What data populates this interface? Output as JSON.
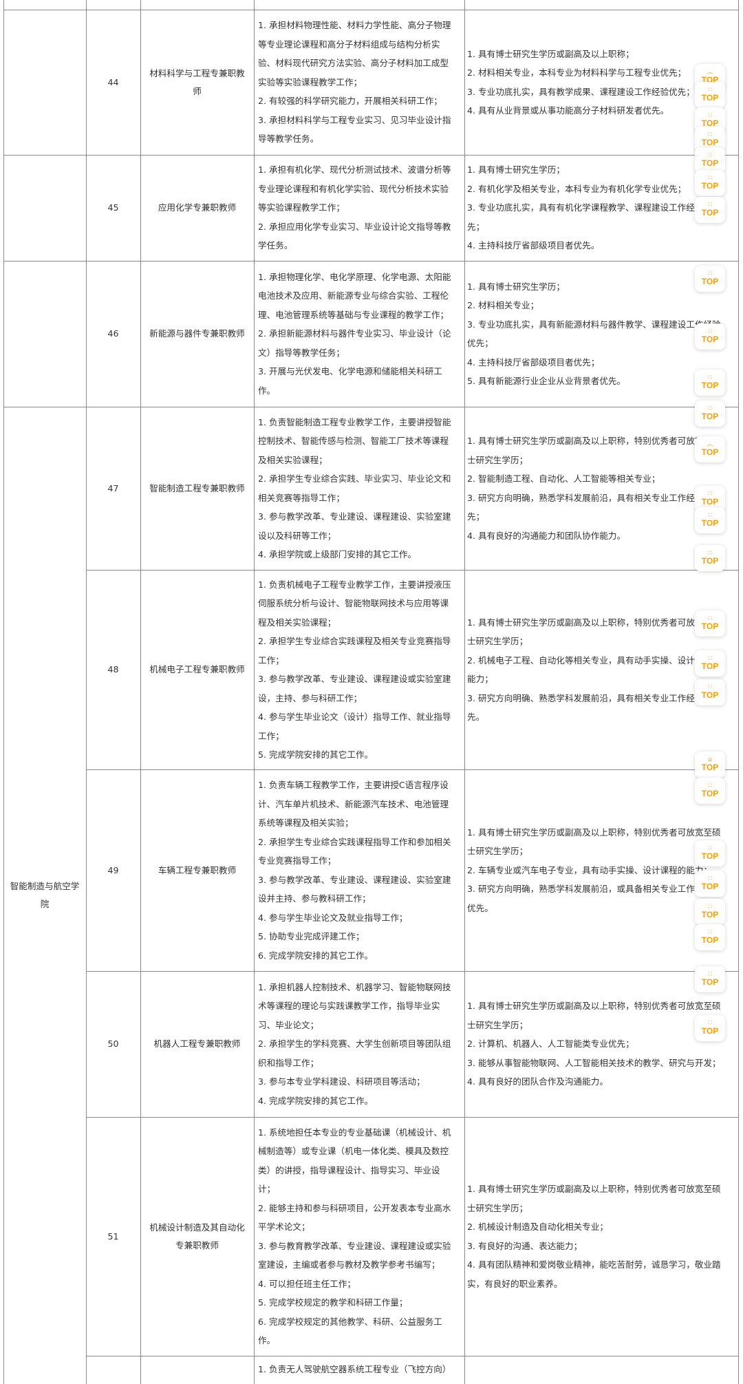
{
  "department": "智能制造与航空学院",
  "rows": [
    {
      "no": "44",
      "position": "材料科学与工程专兼职教师",
      "duties": [
        "1. 承担材料物理性能、材料力学性能、高分子物理",
        "等专业理论课程和高分子材料组成与结构分析实",
        "验、材料现代研究方法实验、高分子材料加工成型",
        "实验等实验课程教学工作；",
        "2. 有较强的科学研究能力，开展相关科研工作；",
        "3. 承担材料科学与工程专业实习、见习毕业设计指",
        "导等教学任务。"
      ],
      "requirements": [
        "1. 具有博士研究生学历或副高及以上职称；",
        "2. 材料相关专业，本科专业为材料科学与工程专业优先；",
        "3. 专业功底扎实，具有教学成果、课程建设工作经验优先；",
        "4. 具有从业背景或从事功能高分子材料研发者优先。"
      ]
    },
    {
      "no": "45",
      "position": "应用化学专兼职教师",
      "duties": [
        "1. 承担有机化学、现代分析测试技术、波谱分析等",
        "专业理论课程和有机化学实验、现代分析技术实验",
        "等实验课程教学工作；",
        "2. 承担应用化学专业实习、毕业设计论文指导等教",
        "学任务。"
      ],
      "requirements": [
        "1. 具有博士研究生学历；",
        "2. 有机化学及相关专业，本科专业为有机化学专业优先；",
        "3. 专业功底扎实，具有有机化学课程教学、课程建设工作经验优",
        "先；",
        "4. 主持科技厅省部级项目者优先。"
      ]
    },
    {
      "no": "46",
      "position": "新能源与器件专兼职教师",
      "duties": [
        "1. 承担物理化学、电化学原理、化学电源、太阳能",
        "电池技术及应用、新能源专业与综合实验、工程伦",
        "理、电池管理系统等基础与专业课程的教学工作；",
        "2. 承担新能源材料与器件专业实习、毕业设计（论",
        "文）指导等教学任务；",
        "3. 开展与光伏发电、化学电源和储能相关科研工",
        "作。"
      ],
      "requirements": [
        "1. 具有博士研究生学历；",
        "2. 材料相关专业；",
        "3. 专业功底扎实，具有新能源材料与器件教学、课程建设工作经验",
        "优先；",
        "4. 主持科技厅省部级项目者优先；",
        "5. 具有新能源行业企业从业背景者优先。"
      ]
    },
    {
      "no": "47",
      "position": "智能制造工程专兼职教师",
      "duties": [
        "1. 负责智能制造工程专业教学工作，主要讲授智能",
        "控制技术、智能传感与检测、智能工厂技术等课程",
        "及相关实验课程；",
        "2. 承担学生专业综合实践、毕业实习、毕业论文和",
        "相关竞赛等指导工作；",
        "3. 参与教学改革、专业建设、课程建设、实验室建",
        "设以及科研等工作；",
        "4. 承担学院或上级部门安排的其它工作。"
      ],
      "requirements": [
        "1. 具有博士研究生学历或副高及以上职称，特别优秀者可放宽至硕",
        "士研究生学历；",
        "2. 智能制造工程、自动化、人工智能等相关专业；",
        "3. 研究方向明确，熟悉学科发展前沿，具有相关专业工作经验者优",
        "先；",
        "4. 具有良好的沟通能力和团队协作能力。"
      ]
    },
    {
      "no": "48",
      "position": "机械电子工程专兼职教师",
      "duties": [
        "1. 负责机械电子工程专业教学工作，主要讲授液压",
        "伺服系统分析与设计、智能物联网技术与应用等课",
        "程及相关实验课程；",
        "2. 承担学生专业综合实践课程及相关专业竞赛指导",
        "工作；",
        "3. 参与教学改革、专业建设、课程建设或实验室建",
        "设，主持、参与科研工作；",
        "4. 参与学生毕业论文（设计）指导工作、就业指导",
        "工作；",
        "5. 完成学院安排的其它工作。"
      ],
      "requirements": [
        "1. 具有博士研究生学历或副高及以上职称，特别优秀者可放宽至硕",
        "士研究生学历；",
        "2. 机械电子工程、自动化等相关专业，具有动手实操、设计课程的",
        "能力；",
        "3. 研究方向明确、熟悉学科发展前沿，具有相关专业工作经验者优",
        "先。"
      ]
    },
    {
      "no": "49",
      "position": "车辆工程专兼职教师",
      "duties": [
        "1. 负责车辆工程教学工作，主要讲授C语言程序设",
        "计、汽车单片机技术、新能源汽车技术、电池管理",
        "系统等课程及相关实验；",
        "2. 承担学生专业综合实践课程指导工作和参加相关",
        "专业竞赛指导工作；",
        "3. 参与教学改革、专业建设、课程建设、实验室建",
        "设并主持、参与教科研工作；",
        "4. 参与学生毕业论文及就业指导工作；",
        "5. 协助专业完成评建工作；",
        "6. 完成学院安排的其它工作。"
      ],
      "requirements": [
        "1. 具有博士研究生学历或副高及以上职称，特别优秀者可放宽至硕",
        "士研究生学历；",
        "2. 车辆专业或汽车电子专业，具有动手实操、设计课程的能力；",
        "3. 研究方向明确，熟悉学科发展前沿，或具备相关专业工作经验者",
        "优先。"
      ]
    },
    {
      "no": "50",
      "position": "机器人工程专兼职教师",
      "duties": [
        "1. 承担机器人控制技术、机器学习、智能物联网技",
        "术等课程的理论与实践课教学工作，指导毕业实",
        "习、毕业论文；",
        "2. 承担学生的学科竞赛、大学生创新项目等团队组",
        "织和指导工作；",
        "3. 参与本专业学科建设、科研项目等活动；",
        "4. 完成学院安排的其它工作。"
      ],
      "requirements": [
        "1. 具有博士研究生学历或副高及以上职称，特别优秀者可放宽至硕",
        "士研究生学历；",
        "2. 计算机、机器人、人工智能类专业优先；",
        "3. 能够从事智能物联网、人工智能相关技术的教学、研究与开发；",
        "4. 具有良好的团队合作及沟通能力。"
      ]
    },
    {
      "no": "51",
      "position": "机械设计制造及其自动化专兼职教师",
      "duties": [
        "1. 系统地担任本专业的专业基础课（机械设计、机",
        "械制造等）或专业课（机电一体化类、模具及数控",
        "类）的讲授，指导课程设计、指导实习、毕业设",
        "计；",
        "2. 能够主持和参与科研项目，公开发表本专业高水",
        "平学术论文；",
        "3. 参与教育教学改革、专业建设、课程建设或实验",
        "室建设，主编或者参与教材及教学参考书编写；",
        "4. 可以担任班主任工作；",
        "5. 完成学校规定的教学和科研工作量；",
        "6. 完成学校规定的其他教学、科研、公益服务工",
        "作。"
      ],
      "requirements": [
        "1. 具有博士研究生学历或副高及以上职称，特别优秀者可放宽至硕",
        "士研究生学历；",
        "2. 机械设计制造及自动化相关专业；",
        "3. 有良好的沟通、表达能力；",
        "4. 具有团队精神和爱岗敬业精神，能吃苦耐劳，诚恳学习，敬业踏",
        "实，有良好的职业素养。"
      ]
    },
    {
      "no": "",
      "position": "",
      "duties": [
        "1. 负责无人驾驶航空器系统工程专业（飞控方向）"
      ],
      "requirements": []
    }
  ],
  "top_badges": [
    {
      "label": "TOP",
      "icon": "chevron-up"
    },
    {
      "label": "TOP",
      "icon": "dots"
    },
    {
      "label": "TOP",
      "icon": "dots"
    },
    {
      "label": "TOP",
      "icon": "dots"
    },
    {
      "label": "TOP",
      "icon": "dots"
    },
    {
      "label": "TOP",
      "icon": "dots"
    },
    {
      "label": "TOP",
      "icon": "dots"
    },
    {
      "label": "TOP",
      "icon": "dots"
    },
    {
      "label": "TOP",
      "icon": "dots"
    },
    {
      "label": "TOP",
      "icon": "dots"
    },
    {
      "label": "TOP",
      "icon": "dots"
    },
    {
      "label": "TOP",
      "icon": "chevron-up"
    },
    {
      "label": "TOP",
      "icon": "dots"
    },
    {
      "label": "TOP",
      "icon": "dots"
    },
    {
      "label": "TOP",
      "icon": "dots"
    },
    {
      "label": "TOP",
      "icon": "dots"
    },
    {
      "label": "TOP",
      "icon": "dots"
    },
    {
      "label": "TOP",
      "icon": "dots"
    },
    {
      "label": "TOP",
      "icon": "home"
    },
    {
      "label": "TOP",
      "icon": "dots"
    },
    {
      "label": "TOP",
      "icon": "dots"
    },
    {
      "label": "TOP",
      "icon": "dots"
    },
    {
      "label": "TOP",
      "icon": "dots"
    },
    {
      "label": "TOP",
      "icon": "dots"
    },
    {
      "label": "TOP",
      "icon": "dots"
    },
    {
      "label": "TOP",
      "icon": "dots"
    }
  ],
  "colors": {
    "accent": "#f5a000",
    "border": "#8a8a8a",
    "text": "#333333"
  }
}
